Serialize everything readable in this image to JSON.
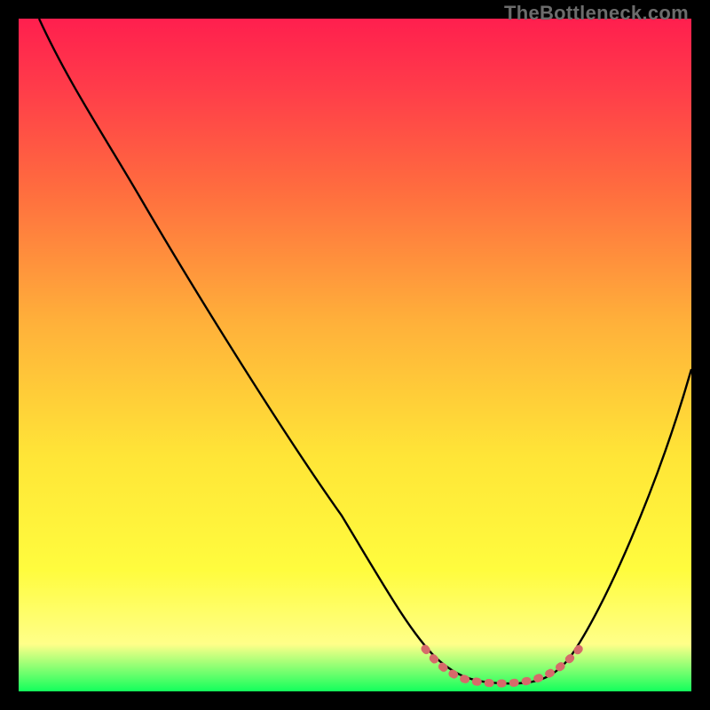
{
  "attribution": "TheBottleneck.com",
  "chart_data": {
    "type": "line",
    "title": "",
    "xlabel": "",
    "ylabel": "",
    "xlim": [
      0,
      100
    ],
    "ylim": [
      0,
      100
    ],
    "grid": false,
    "legend": false,
    "series": [
      {
        "name": "bottleneck-curve",
        "color": "#000000",
        "x": [
          3,
          10,
          18,
          32,
          48,
          58,
          62,
          66,
          72,
          78,
          82,
          100
        ],
        "y": [
          100,
          90,
          79,
          58,
          34,
          14,
          5,
          2,
          1,
          2,
          5,
          48
        ]
      },
      {
        "name": "optimal-range-marker",
        "color": "#d66a6a",
        "x": [
          60,
          63,
          66,
          69,
          72,
          75,
          78,
          81,
          84
        ],
        "y": [
          5.5,
          3,
          2,
          1.5,
          1.2,
          1.5,
          2,
          3,
          5.5
        ]
      }
    ],
    "gradient_stops": [
      {
        "pos": 0,
        "color": "#ff1f4e"
      },
      {
        "pos": 10,
        "color": "#ff3b4a"
      },
      {
        "pos": 25,
        "color": "#ff6b3f"
      },
      {
        "pos": 45,
        "color": "#ffb03a"
      },
      {
        "pos": 65,
        "color": "#ffe537"
      },
      {
        "pos": 82,
        "color": "#fffc3e"
      },
      {
        "pos": 93,
        "color": "#ffff89"
      },
      {
        "pos": 100,
        "color": "#13ff5c"
      }
    ]
  }
}
